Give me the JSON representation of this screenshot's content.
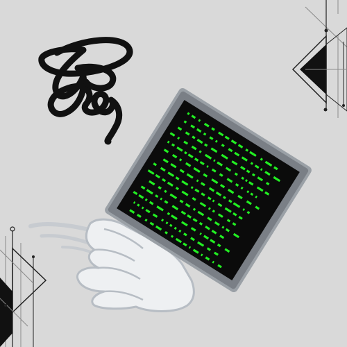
{
  "illustration": {
    "subject": "hand-tossed-computer-screen",
    "colors": {
      "background": "#d9d9d9",
      "scribble": "#111111",
      "screen_frame": "#7a7f86",
      "screen_frame_outer": "#9aa0a6",
      "screen_display": "#0b0b0b",
      "code": "#22ee22",
      "hand_fill": "#eef0f2",
      "hand_outline": "#b7bdc4",
      "decor_line": "#222222",
      "decor_gray": "#8a8a8a"
    },
    "icons": [
      "scribble-icon",
      "terminal-screen-icon",
      "hand-icon",
      "triangle-decoration-icon"
    ]
  }
}
